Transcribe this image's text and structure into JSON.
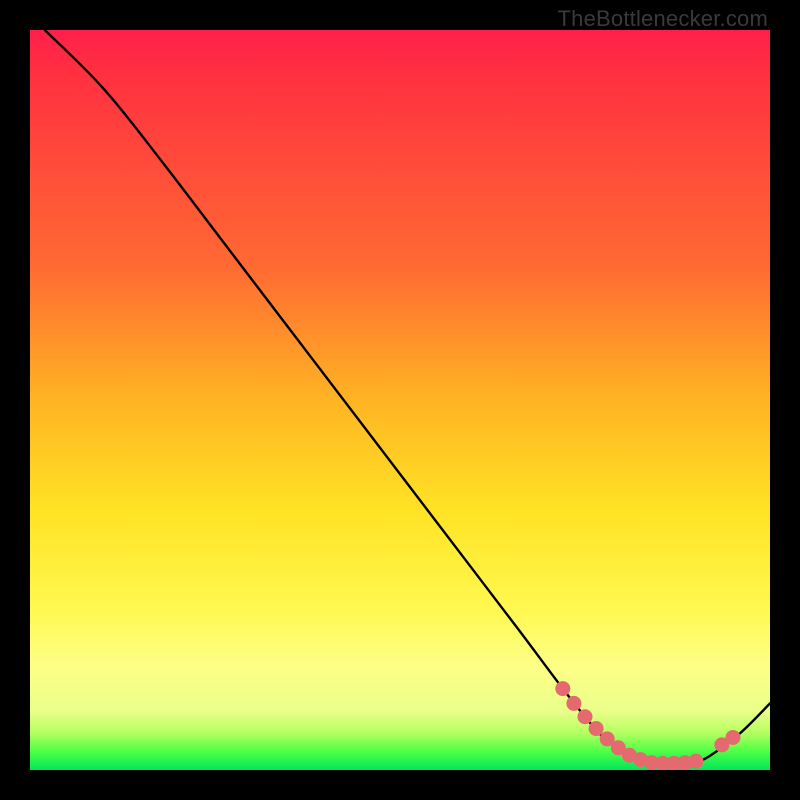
{
  "watermark": "TheBottlenecker.com",
  "chart_data": {
    "type": "line",
    "title": "",
    "xlabel": "",
    "ylabel": "",
    "xlim": [
      0,
      100
    ],
    "ylim": [
      0,
      100
    ],
    "series": [
      {
        "name": "curve",
        "x": [
          2,
          10,
          18,
          26,
          34,
          42,
          50,
          58,
          66,
          72,
          76,
          78,
          80,
          82,
          84,
          86,
          88,
          90,
          92,
          96,
          100
        ],
        "y": [
          100,
          92,
          82,
          71.5,
          61,
          50.5,
          40,
          29.5,
          19,
          11,
          6,
          4,
          2.8,
          1.6,
          1.0,
          0.9,
          0.9,
          1.1,
          2.0,
          5.0,
          9.0
        ]
      }
    ],
    "markers": [
      {
        "x": 72.0,
        "y": 11.0
      },
      {
        "x": 73.5,
        "y": 9.0
      },
      {
        "x": 75.0,
        "y": 7.2
      },
      {
        "x": 76.5,
        "y": 5.6
      },
      {
        "x": 78.0,
        "y": 4.2
      },
      {
        "x": 79.5,
        "y": 3.0
      },
      {
        "x": 81.0,
        "y": 2.0
      },
      {
        "x": 82.5,
        "y": 1.4
      },
      {
        "x": 84.0,
        "y": 1.0
      },
      {
        "x": 85.5,
        "y": 0.9
      },
      {
        "x": 87.0,
        "y": 0.9
      },
      {
        "x": 88.5,
        "y": 1.0
      },
      {
        "x": 90.0,
        "y": 1.2
      },
      {
        "x": 93.5,
        "y": 3.4
      },
      {
        "x": 95.0,
        "y": 4.4
      }
    ],
    "colors": {
      "curve": "#000000",
      "marker": "#e46a6f"
    }
  }
}
